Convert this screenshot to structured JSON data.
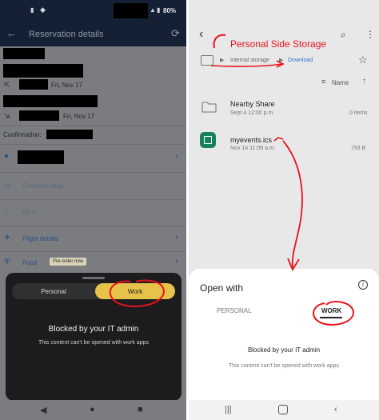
{
  "left": {
    "status": {
      "battery": "80%"
    },
    "appbar": {
      "title": "Reservation details"
    },
    "dates": [
      "Fri, Nov 17",
      "Fri, Nov 17"
    ],
    "confirmation_label": "Confirmation:",
    "list_items": [
      {
        "label": "Checked bags",
        "icon": "bag-icon"
      },
      {
        "label": "Wi-Fi",
        "icon": "wifi-icon"
      },
      {
        "label": "Flight details",
        "icon": "plane-icon"
      },
      {
        "label": "Food",
        "icon": "food-icon",
        "badge": "Pre-order now"
      }
    ],
    "sheet": {
      "tab_personal": "Personal",
      "tab_work": "Work",
      "blocked_title": "Blocked by your IT admin",
      "blocked_sub": "This content can't be opened with work apps"
    }
  },
  "right": {
    "annotation": "Personal Side Storage",
    "breadcrumb": {
      "internal": "Internal storage",
      "download": "Download"
    },
    "sort": {
      "label": "Name"
    },
    "files": [
      {
        "name": "Nearby Share",
        "date": "Sept 4 12:00 p.m.",
        "meta": "0 items",
        "icon": "folder-icon"
      },
      {
        "name": "myevents.ics",
        "date": "Nov 14 11:09 a.m.",
        "meta": "793 B",
        "icon": "calendar-file-icon"
      }
    ],
    "sheet": {
      "title": "Open with",
      "tab_personal": "PERSONAL",
      "tab_work": "WORK",
      "blocked_title": "Blocked by your IT admin",
      "blocked_sub": "This content can't be opened with work apps"
    }
  },
  "colors": {
    "appbar": "#142033",
    "work_pill": "#e6c24a",
    "annotation_red": "#e8121b",
    "link_blue": "#2f6fd1"
  }
}
